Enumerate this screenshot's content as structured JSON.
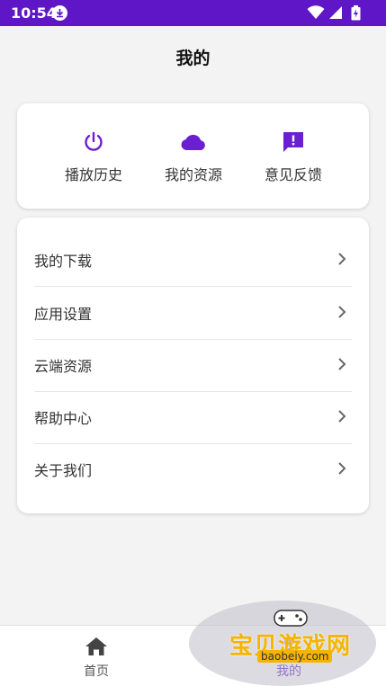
{
  "status_bar": {
    "time": "10:54",
    "bg": "#5f16c6"
  },
  "header": {
    "title": "我的"
  },
  "quick_actions": [
    {
      "label": "播放历史",
      "icon": "power-icon"
    },
    {
      "label": "我的资源",
      "icon": "cloud-icon"
    },
    {
      "label": "意见反馈",
      "icon": "feedback-icon"
    }
  ],
  "menu": [
    {
      "label": "我的下载"
    },
    {
      "label": "应用设置"
    },
    {
      "label": "云端资源"
    },
    {
      "label": "帮助中心"
    },
    {
      "label": "关于我们"
    }
  ],
  "bottom_nav": [
    {
      "label": "首页",
      "icon": "home-icon"
    },
    {
      "label": "我的",
      "icon": "user-icon"
    }
  ],
  "watermark": {
    "text": "宝贝游戏网",
    "url": "baobeiy.com"
  },
  "colors": {
    "accent": "#6a1fd1"
  }
}
